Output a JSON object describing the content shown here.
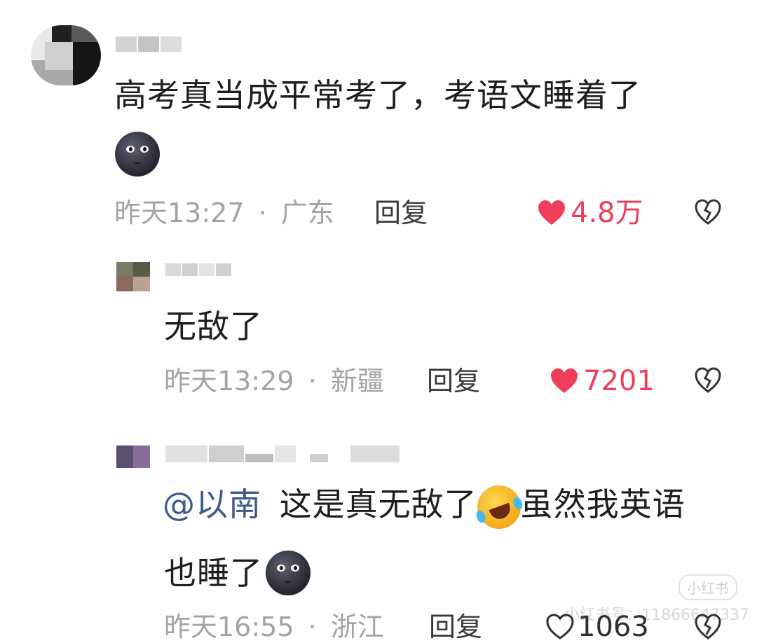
{
  "comments": [
    {
      "text": "高考真当成平常考了，考语文睡着了",
      "time": "昨天13:27",
      "location": "广东",
      "reply_label": "回复",
      "likes": "4.8万",
      "liked": true
    },
    {
      "text": "无敌了",
      "time": "昨天13:29",
      "location": "新疆",
      "reply_label": "回复",
      "likes": "7201",
      "liked": true
    },
    {
      "mention": "@以南",
      "text_part1": "这是真无敌了",
      "text_part2": "虽然我英语",
      "text_part3": "也睡了",
      "time": "昨天16:55",
      "location": "浙江",
      "reply_label": "回复",
      "likes": "1063",
      "liked": false
    }
  ],
  "separator": "·",
  "watermark": {
    "badge": "小红书",
    "line": "小红书号：11866647337"
  },
  "colors": {
    "like_red": "#ef3d5a",
    "mention_blue": "#3c5a8a",
    "meta_gray": "#a3a3a3"
  },
  "icons": [
    "heart-filled-icon",
    "heart-outline-icon",
    "broken-heart-icon",
    "moon-face-emoji",
    "rolling-laugh-emoji"
  ]
}
